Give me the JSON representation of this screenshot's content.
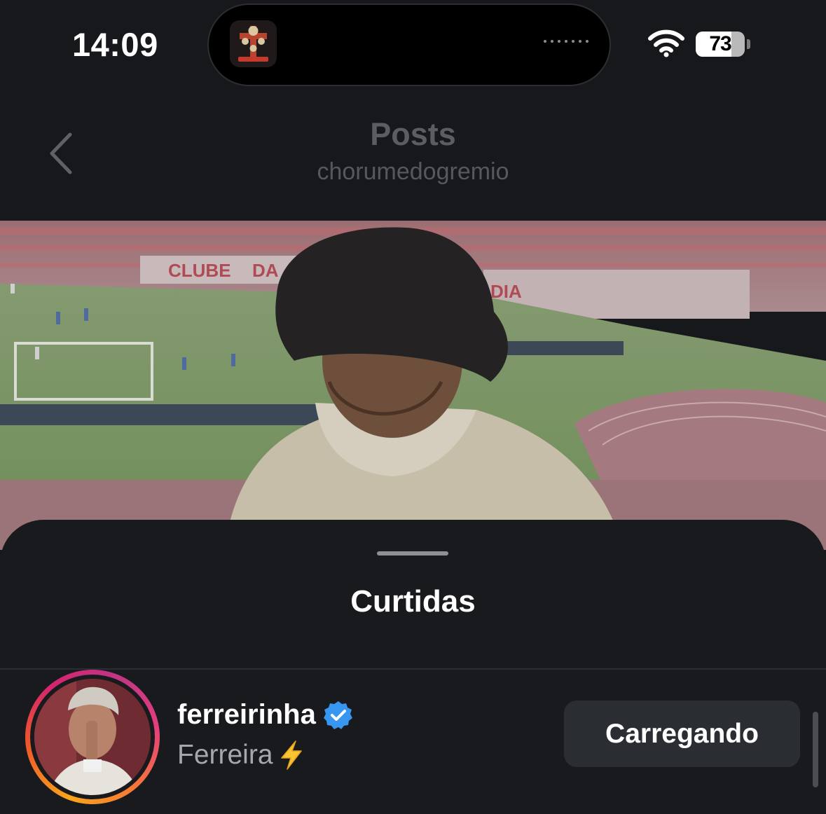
{
  "status_bar": {
    "time": "14:09",
    "battery_level": "73",
    "battery_fraction": 0.73,
    "wifi_icon": "wifi-icon",
    "island_app_icon": "guns-n-roses-cross-logo"
  },
  "nav": {
    "title": "Posts",
    "subtitle": "chorumedogremio",
    "back_icon": "chevron-left-icon"
  },
  "post": {
    "image": "man-in-bucket-hat-at-stadium"
  },
  "sheet": {
    "title": "Curtidas"
  },
  "likes": [
    {
      "username": "ferreirinha",
      "verified": true,
      "full_name": "Ferreira",
      "full_name_emoji": "lightning-icon",
      "button_label": "Carregando"
    }
  ],
  "colors": {
    "background": "#16181b",
    "sheet": "#181a1d",
    "button": "#2a2e33",
    "verified": "#3797f0",
    "dim_text": "#5a5d61"
  }
}
